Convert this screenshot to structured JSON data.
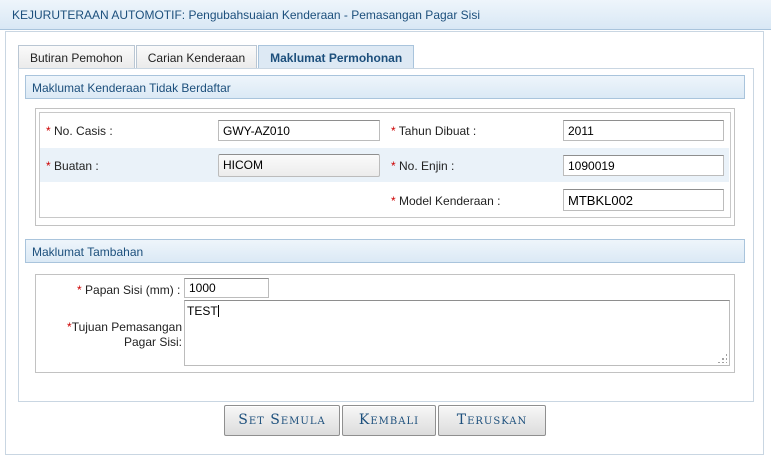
{
  "window": {
    "title": "KEJURUTERAAN AUTOMOTIF: Pengubahsuaian Kenderaan - Pemasangan Pagar Sisi"
  },
  "tabs": [
    {
      "label": "Butiran Pemohon",
      "active": false
    },
    {
      "label": "Carian Kenderaan",
      "active": false
    },
    {
      "label": "Maklumat Permohonan",
      "active": true
    }
  ],
  "section_vehicle": {
    "title": "Maklumat Kenderaan Tidak Berdaftar",
    "required_mark": "*",
    "no_casis": {
      "label": "No. Casis :",
      "value": "GWY-AZ010"
    },
    "tahun_dibuat": {
      "label": "Tahun Dibuat :",
      "value": "2011"
    },
    "buatan": {
      "label": "Buatan :",
      "value": "HICOM"
    },
    "no_enjin": {
      "label": "No. Enjin :",
      "value": "1090019"
    },
    "model": {
      "label": "Model Kenderaan :",
      "value": "MTBKL002"
    }
  },
  "section_extra": {
    "title": "Maklumat Tambahan",
    "required_mark": "*",
    "papan_sisi": {
      "label": "Papan Sisi (mm) :",
      "value": "1000"
    },
    "tujuan": {
      "label_line1": "Tujuan Pemasangan",
      "label_line2": "Pagar Sisi:",
      "value": "TEST"
    }
  },
  "buttons": {
    "reset": "Set Semula",
    "back": "Kembali",
    "next": "Teruskan"
  },
  "colors": {
    "accent_text": "#1c4f7c",
    "header_bg": "#dbe9f5",
    "row_shade": "#eaf2f9",
    "required": "#cc0000"
  }
}
